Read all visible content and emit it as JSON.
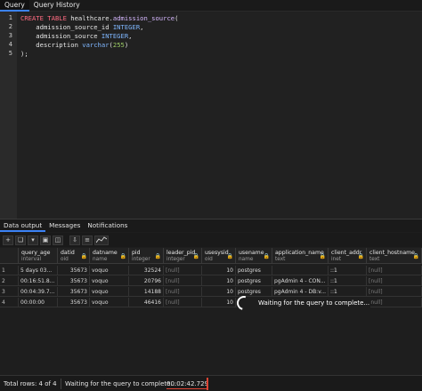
{
  "top_tabs": [
    {
      "label": "Query"
    },
    {
      "label": "Query History"
    }
  ],
  "editor": {
    "line_numbers": [
      "1",
      "2",
      "3",
      "4",
      "5"
    ],
    "lines": [
      {
        "a": "CREATE TABLE",
        "b": " healthcare.",
        "c": "admission_source",
        "d": "("
      },
      {
        "a": "    admission_source_id ",
        "b": "INTEGER",
        "c": ","
      },
      {
        "a": "    admission_source ",
        "b": "INTEGER",
        "c": ","
      },
      {
        "a": "    description ",
        "b": "varchar",
        "c": "(",
        "d": "255",
        "e": ")"
      },
      {
        "a": ");"
      }
    ]
  },
  "bottom_tabs": [
    {
      "label": "Data output"
    },
    {
      "label": "Messages"
    },
    {
      "label": "Notifications"
    }
  ],
  "toolbar": {
    "icons": [
      "add-row-icon",
      "copy-icon",
      "copy-options-icon",
      "paste-icon",
      "delete-icon",
      "download-icon",
      "filter-icon",
      "graph-icon"
    ]
  },
  "grid": {
    "columns": [
      {
        "name": "query_age",
        "type": "interval"
      },
      {
        "name": "datid",
        "type": "oid"
      },
      {
        "name": "datname",
        "type": "name"
      },
      {
        "name": "pid",
        "type": "integer"
      },
      {
        "name": "leader_pid",
        "type": "integer"
      },
      {
        "name": "usesysid",
        "type": "oid"
      },
      {
        "name": "usename",
        "type": "name"
      },
      {
        "name": "application_name",
        "type": "text"
      },
      {
        "name": "client_addr",
        "type": "inet"
      },
      {
        "name": "client_hostname",
        "type": "text"
      }
    ],
    "rows": [
      {
        "num": "1",
        "cells": [
          "5 days 03...",
          "35673",
          "voquo",
          "32524",
          "[null]",
          "10",
          "postgres",
          "",
          "::1",
          "[null]"
        ]
      },
      {
        "num": "2",
        "cells": [
          "00:16:51.8...",
          "35673",
          "voquo",
          "20796",
          "[null]",
          "10",
          "postgres",
          "pgAdmin 4 - CON...",
          "::1",
          "[null]"
        ]
      },
      {
        "num": "3",
        "cells": [
          "00:04:39.7...",
          "35673",
          "voquo",
          "14188",
          "[null]",
          "10",
          "postgres",
          "pgAdmin 4 - DB:v...",
          "::1",
          "[null]"
        ]
      },
      {
        "num": "4",
        "cells": [
          "00:00:00",
          "35673",
          "voquo",
          "46416",
          "[null]",
          "10",
          "postgr",
          "",
          "",
          "[null]"
        ]
      }
    ]
  },
  "overlay": {
    "message": "Waiting for the query to complete..."
  },
  "status": {
    "rows": "Total rows: 4 of 4",
    "message": "Waiting for the query to complete...",
    "elapsed": "00:02:42.729"
  }
}
